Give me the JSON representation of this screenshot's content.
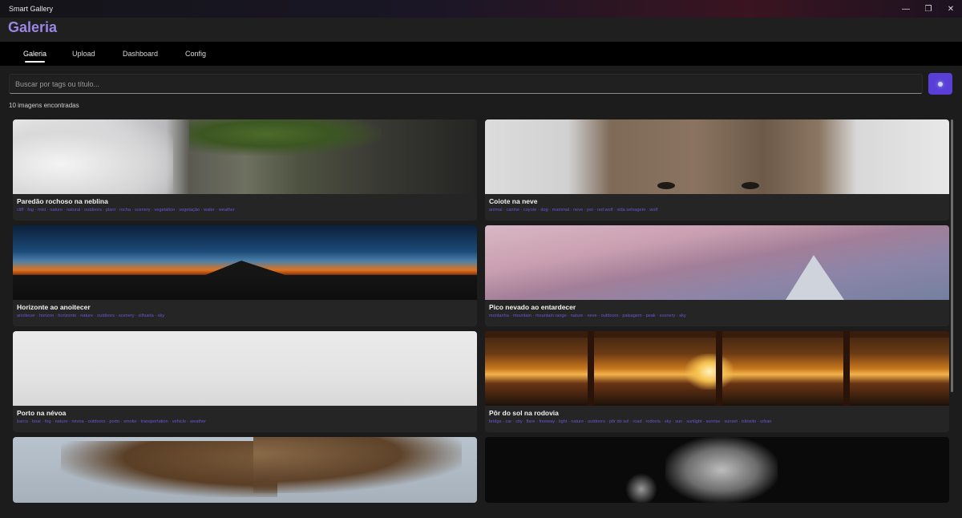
{
  "window": {
    "title": "Smart Gallery",
    "controls": [
      "minimize-icon",
      "restore-icon",
      "close-icon"
    ]
  },
  "header": {
    "title": "Galeria"
  },
  "tabs": [
    {
      "label": "Galeria",
      "active": true
    },
    {
      "label": "Upload",
      "active": false
    },
    {
      "label": "Dashboard",
      "active": false
    },
    {
      "label": "Config",
      "active": false
    }
  ],
  "search": {
    "placeholder": "Buscar por tags ou título...",
    "value": "",
    "button_icon": "search-icon"
  },
  "results": {
    "count_text": "10 imagens encontradas"
  },
  "colors": {
    "accent": "#5a3fd6",
    "title_accent": "#9b86e6",
    "tag_color": "#6b55d6"
  },
  "cards": [
    {
      "title": "Paredão rochoso na neblina",
      "tags": "cliff · fog · mist · nature · natural · outdoors · plant · rocha · scenery · vegetation · vegetação · water · weather"
    },
    {
      "title": "Coiote na neve",
      "tags": "animal · canine · coyote · dog · mammal · neve · pet · red wolf · vida selvagem · wolf"
    },
    {
      "title": "Horizonte ao anoitecer",
      "tags": "anoitecer · horizon · horizonte · nature · outdoors · scenery · silhueta · sky"
    },
    {
      "title": "Pico nevado ao entardecer",
      "tags": "montanha · mountain · mountain range · nature · neve · outdoors · paisagem · peak · scenery · sky"
    },
    {
      "title": "Porto na névoa",
      "tags": "barco · boat · fog · nature · névoa · outdoors · porto · smoke · transportation · vehicle · weather"
    },
    {
      "title": "Pôr do sol na rodovia",
      "tags": "bridge · car · city · flare · freeway · light · nature · outdoors · pôr do sol · road · rodovia · sky · sun · sunlight · sunrise · sunset · trânsito · urban"
    },
    {
      "title": "",
      "tags": ""
    },
    {
      "title": "",
      "tags": ""
    }
  ]
}
